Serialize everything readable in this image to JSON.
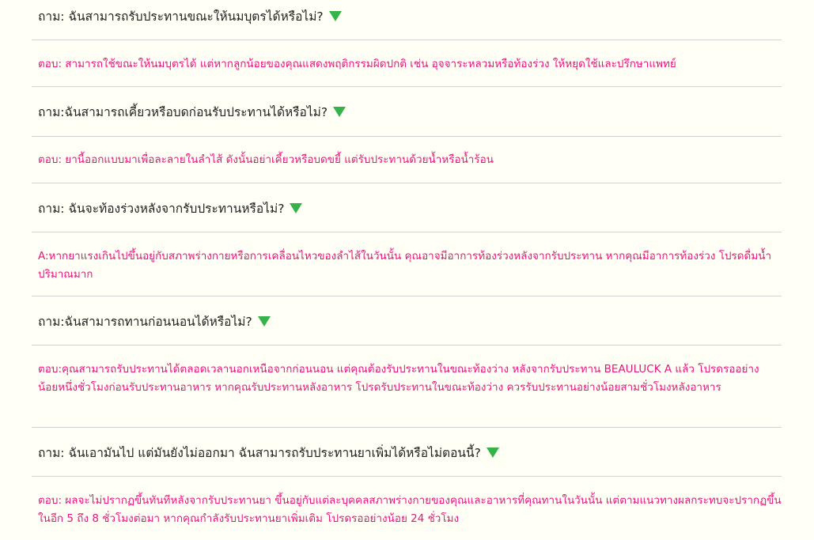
{
  "faq": [
    {
      "question": "ถาม: ฉันสามารถรับประทานขณะให้นมบุตรได้หรือไม่?",
      "answer": "ตอบ: สามารถใช้ขณะให้นมบุตรได้ แต่หากลูกน้อยของคุณแสดงพฤติกรรมผิดปกติ เช่น อุจจาระหลวมหรือท้องร่วง ให้หยุดใช้และปรึกษาแพทย์"
    },
    {
      "question": "ถาม:ฉันสามารถเคี้ยวหรือบดก่อนรับประทานได้หรือไม่?",
      "answer": "ตอบ: ยานี้ออกแบบมาเพื่อละลายในลำไส้ ดังนั้นอย่าเคี้ยวหรือบดขยี้ แต่รับประทานด้วยน้ำหรือน้ำร้อน"
    },
    {
      "question": "ถาม: ฉันจะท้องร่วงหลังจากรับประทานหรือไม่?",
      "answer": "A:หากยาแรงเกินไปขึ้นอยู่กับสภาพร่างกายหรือการเคลื่อนไหวของลำไส้ในวันนั้น คุณอาจมีอาการท้องร่วงหลังจากรับประทาน หากคุณมีอาการท้องร่วง โปรดดื่มน้ำปริมาณมาก"
    },
    {
      "question": "ถาม:ฉันสามารถทานก่อนนอนได้หรือไม่?",
      "answer": "ตอบ:คุณสามารถรับประทานได้ตลอดเวลานอกเหนือจากก่อนนอน แต่คุณต้องรับประทานในขณะท้องว่าง หลังจากรับประทาน BEAULUCK A แล้ว โปรดรออย่างน้อยหนึ่งชั่วโมงก่อนรับประทานอาหาร หากคุณรับประทานหลังอาหาร โปรดรับประทานในขณะท้องว่าง ควรรับประทานอย่างน้อยสามชั่วโมงหลังอาหาร"
    },
    {
      "question": "ถาม: ฉันเอามันไป แต่มันยังไม่ออกมา ฉันสามารถรับประทานยาเพิ่มได้หรือไม่ตอนนี้?",
      "answer": "ตอบ: ผลจะไม่ปรากฏขึ้นทันทีหลังจากรับประทานยา ขึ้นอยู่กับแต่ละบุคคลสภาพร่างกายของคุณและอาหารที่คุณทานในวันนั้น แต่ตามแนวทางผลกระทบจะปรากฏขึ้นในอีก 5 ถึง 8 ชั่วโมงต่อมา หากคุณกำลังรับประทานยาเพิ่มเติม โปรดรออย่างน้อย 24 ชั่วโมง"
    }
  ],
  "icons": {
    "expand": "triangle-down-icon"
  },
  "colors": {
    "background": "#fffff5",
    "question_text": "#222222",
    "answer_text": "#e5167e",
    "arrow": "#36b24a",
    "divider": "#d4d4d4"
  }
}
